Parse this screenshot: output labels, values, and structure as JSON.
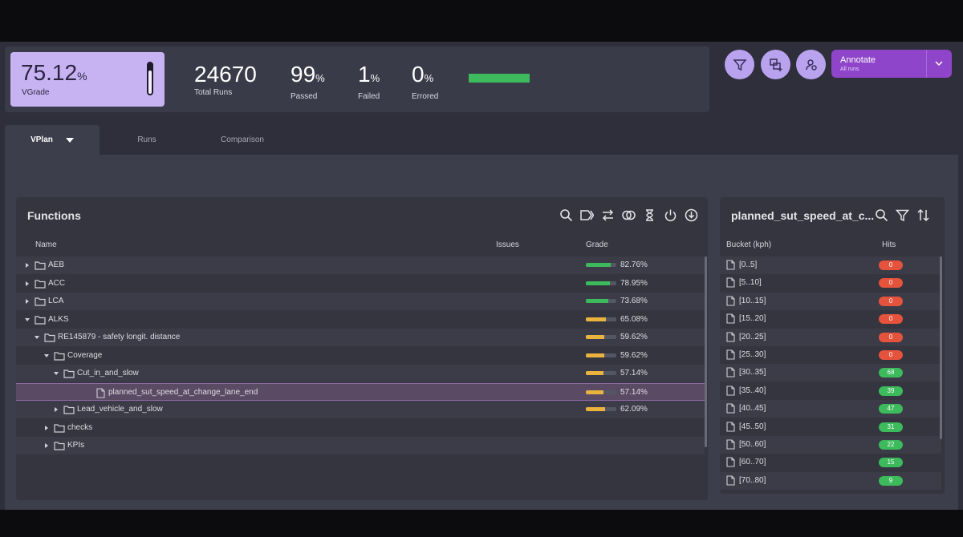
{
  "stats": {
    "vgrade_value": "75.12",
    "vgrade_unit": "%",
    "vgrade_label": "VGrade",
    "vgrade_level": 0.7512,
    "total_runs": "24670",
    "total_runs_label": "Total Runs",
    "passed_value": "99",
    "passed_unit": "%",
    "passed_label": "Passed",
    "failed_value": "1",
    "failed_unit": "%",
    "failed_label": "Failed",
    "errored_value": "0",
    "errored_unit": "%",
    "errored_label": "Errored"
  },
  "toolbar": {
    "icons": [
      "filter-icon",
      "add-chart-icon",
      "user-settings-icon"
    ],
    "annotate_label": "Annotate",
    "annotate_sub": "All runs"
  },
  "tabs": [
    {
      "label": "VPlan",
      "active": true
    },
    {
      "label": "Runs",
      "active": false
    },
    {
      "label": "Comparison",
      "active": false
    }
  ],
  "functions": {
    "title": "Functions",
    "columns": {
      "name": "Name",
      "issues": "Issues",
      "grade": "Grade"
    },
    "icons": [
      "search-icon",
      "tag-icon",
      "swap-icon",
      "overlap-icon",
      "hourglass-icon",
      "power-icon",
      "download-icon"
    ],
    "rows": [
      {
        "name": "AEB",
        "grade": "82.76%",
        "fill": 0.8276,
        "color": "#3cba5c",
        "type": "folder",
        "expanded": false
      },
      {
        "name": "ACC",
        "grade": "78.95%",
        "fill": 0.7895,
        "color": "#3cba5c",
        "type": "folder",
        "expanded": false
      },
      {
        "name": "LCA",
        "grade": "73.68%",
        "fill": 0.7368,
        "color": "#3cba5c",
        "type": "folder",
        "expanded": false
      },
      {
        "name": "ALKS",
        "grade": "65.08%",
        "fill": 0.6508,
        "color": "#e9b33e",
        "type": "folder",
        "expanded": true
      },
      {
        "name": "RE145879 - safety longit. distance",
        "grade": "59.62%",
        "fill": 0.5962,
        "color": "#e9b33e",
        "type": "folder",
        "expanded": true
      },
      {
        "name": "Coverage",
        "grade": "59.62%",
        "fill": 0.5962,
        "color": "#e9b33e",
        "type": "folder",
        "expanded": true
      },
      {
        "name": "Cut_in_and_slow",
        "grade": "57.14%",
        "fill": 0.5714,
        "color": "#e9b33e",
        "type": "folder",
        "expanded": true
      },
      {
        "name": "planned_sut_speed_at_change_lane_end",
        "grade": "57.14%",
        "fill": 0.5714,
        "color": "#e9b33e",
        "type": "file",
        "selected": true
      },
      {
        "name": "Lead_vehicle_and_slow",
        "grade": "62.09%",
        "fill": 0.6209,
        "color": "#e9b33e",
        "type": "folder",
        "expanded": false
      },
      {
        "name": "checks",
        "grade": "",
        "fill": 0,
        "color": "",
        "type": "folder",
        "expanded": false
      },
      {
        "name": "KPIs",
        "grade": "",
        "fill": 0,
        "color": "",
        "type": "folder",
        "expanded": false
      }
    ]
  },
  "buckets": {
    "title": "planned_sut_speed_at_c...",
    "columns": {
      "bucket": "Bucket (kph)",
      "hits": "Hits"
    },
    "icons": [
      "search-icon",
      "filter-icon",
      "sort-icon"
    ],
    "rows": [
      {
        "bucket": "[0..5]",
        "hits": "0",
        "color": "#e5533d"
      },
      {
        "bucket": "[5..10]",
        "hits": "0",
        "color": "#e5533d"
      },
      {
        "bucket": "[10..15]",
        "hits": "0",
        "color": "#e5533d"
      },
      {
        "bucket": "[15..20]",
        "hits": "0",
        "color": "#e5533d"
      },
      {
        "bucket": "[20..25]",
        "hits": "0",
        "color": "#e5533d"
      },
      {
        "bucket": "[25..30]",
        "hits": "0",
        "color": "#e5533d"
      },
      {
        "bucket": "[30..35]",
        "hits": "68",
        "color": "#3cba5c"
      },
      {
        "bucket": "[35..40]",
        "hits": "39",
        "color": "#3cba5c"
      },
      {
        "bucket": "[40..45]",
        "hits": "47",
        "color": "#3cba5c"
      },
      {
        "bucket": "[45..50]",
        "hits": "31",
        "color": "#3cba5c"
      },
      {
        "bucket": "[50..60]",
        "hits": "22",
        "color": "#3cba5c"
      },
      {
        "bucket": "[60..70]",
        "hits": "15",
        "color": "#3cba5c"
      },
      {
        "bucket": "[70..80]",
        "hits": "9",
        "color": "#3cba5c"
      }
    ]
  }
}
